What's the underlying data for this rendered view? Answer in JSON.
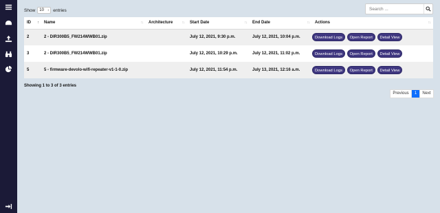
{
  "sidebar": {
    "icons": [
      "menu-icon",
      "dashboard-icon",
      "upload-icon",
      "binoculars-icon",
      "pie-chart-icon"
    ],
    "bottom_icon": "logout-icon"
  },
  "controls": {
    "show_label": "Show",
    "page_length": "10",
    "entries_label": "entries",
    "search_placeholder": "Search ...",
    "search_value": ""
  },
  "table": {
    "columns": [
      "ID",
      "Name",
      "Architecture",
      "Start Date",
      "End Date",
      "Actions"
    ],
    "sorted_column": "ID",
    "rows": [
      {
        "id": "2",
        "name": "2 - DIR300B5_FW214WWB01.zip",
        "architecture": "",
        "start": "July 12, 2021, 9:30 p.m.",
        "end": "July 12, 2021, 10:04 p.m."
      },
      {
        "id": "3",
        "name": "2 - DIR300B5_FW214WWB01.zip",
        "architecture": "",
        "start": "July 12, 2021, 10:29 p.m.",
        "end": "July 12, 2021, 11:02 p.m."
      },
      {
        "id": "5",
        "name": "5 - firmware-devolo-wifi-repeater-v1-1-0.zip",
        "architecture": "",
        "start": "July 12, 2021, 11:54 p.m.",
        "end": "July 13, 2021, 12:16 a.m."
      }
    ],
    "action_labels": {
      "download": "Download Logs",
      "report": "Open Report",
      "detail": "Detail View"
    }
  },
  "footer": {
    "info": "Showing 1 to 3 of 3 entries",
    "previous": "Previous",
    "current_page": "1",
    "next": "Next"
  },
  "colors": {
    "sidebar": "#1b1a37",
    "background": "#d7e1ea",
    "button": "#3f3780",
    "active_page": "#0d6efd"
  }
}
